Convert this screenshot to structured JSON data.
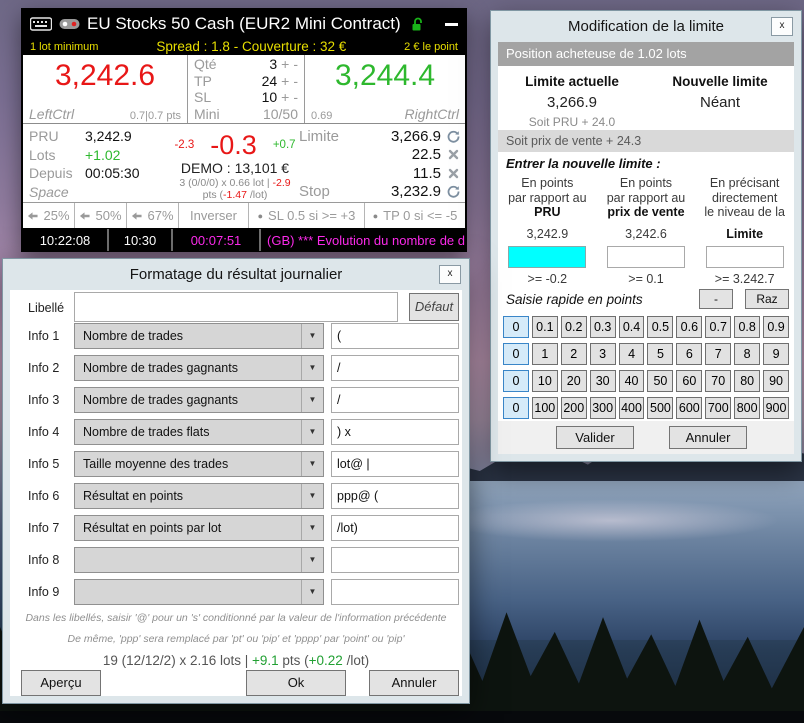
{
  "colors": {
    "sell_red": "#e81717",
    "buy_green": "#2eb82e",
    "magenta": "#ff2bee",
    "yellow": "#e8df00",
    "cyan_input": "#00ffff"
  },
  "trading_panel": {
    "title": "EU Stocks 50 Cash (EUR2 Mini Contract)",
    "info_left": "1 lot minimum",
    "info_center": "Spread : 1.8 - Couverture : 32 €",
    "info_right": "2 € le point",
    "sell_price": "3,242.6",
    "sell_key": "LeftCtrl",
    "sell_info": "0.7|0.7 pts",
    "buy_price": "3,244.4",
    "buy_key": "RightCtrl",
    "buy_info": "0.69",
    "plus": "+",
    "minus": "-",
    "order_rows": [
      {
        "label": "Qté",
        "value": "3"
      },
      {
        "label": "TP",
        "value": "24"
      },
      {
        "label": "SL",
        "value": "10"
      },
      {
        "label": "Mini",
        "value": "10/50"
      }
    ],
    "pos_rows": [
      {
        "label": "PRU",
        "value": "3,242.9"
      },
      {
        "label": "Lots",
        "value": "+1.02"
      },
      {
        "label": "Depuis",
        "value": "00:05:30"
      },
      {
        "label": "Space",
        "value": ""
      }
    ],
    "pnl_low": "-2.3",
    "pnl_main": "-0.3",
    "pnl_high": "+0.7",
    "demo": "DEMO : 13,101 €",
    "stats": {
      "p1": "3 (0/0/0) x 0.66 lot | ",
      "neg1": "-2.9",
      "p2": " pts (",
      "neg2": "-1.47",
      "p3": " /lot)"
    },
    "limite_label": "Limite",
    "limite_value": "3,266.9",
    "row2_value": "22.5",
    "row3_value": "11.5",
    "stop_label": "Stop",
    "stop_value": "3,232.9",
    "pct_buttons": [
      "25%",
      "50%",
      "67%"
    ],
    "inverser": "Inverser",
    "sl_rule": "SL 0.5 si >= +3",
    "tp_rule": "TP 0 si <= -5",
    "status": [
      "10:22:08",
      "10:30",
      "00:07:51"
    ],
    "ticker": "(GB) *** Evolution du nombre de demandeu..."
  },
  "limit_dialog": {
    "title": "Modification de la limite",
    "close": "x",
    "position_header": "Position acheteuse de 1.02 lots",
    "current_label": "Limite actuelle",
    "current_value": "3,266.9",
    "current_note": "Soit PRU + 24.0",
    "new_label": "Nouvelle limite",
    "new_value": "Néant",
    "sale_note": "Soit prix de vente + 24.3",
    "enter_label": "Entrer la nouvelle limite :",
    "col1": {
      "l1": "En points",
      "l2": "par rapport au",
      "bold": "PRU",
      "ref": "3,242.9",
      "min": ">= -0.2"
    },
    "col2": {
      "l1": "En points",
      "l2": "par rapport au",
      "bold": "prix de vente",
      "ref": "3,242.6",
      "min": ">= 0.1"
    },
    "col3": {
      "l1": "En précisant",
      "l2": "directement",
      "l3": "le niveau de la",
      "bold": "Limite",
      "min": ">= 3.242.7"
    },
    "quick_label": "Saisie rapide en points",
    "minus_button": "-",
    "raz_button": "Raz",
    "grid": [
      [
        "0",
        "0.1",
        "0.2",
        "0.3",
        "0.4",
        "0.5",
        "0.6",
        "0.7",
        "0.8",
        "0.9"
      ],
      [
        "0",
        "1",
        "2",
        "3",
        "4",
        "5",
        "6",
        "7",
        "8",
        "9"
      ],
      [
        "0",
        "10",
        "20",
        "30",
        "40",
        "50",
        "60",
        "70",
        "80",
        "90"
      ],
      [
        "0",
        "100",
        "200",
        "300",
        "400",
        "500",
        "600",
        "700",
        "800",
        "900"
      ]
    ],
    "valider": "Valider",
    "annuler": "Annuler"
  },
  "format_dialog": {
    "title": "Formatage du résultat journalier",
    "close": "x",
    "libelle_label": "Libellé",
    "libelle_value": "",
    "defaut_button": "Défaut",
    "rows": [
      {
        "label": "Info 1",
        "select": "Nombre de trades",
        "value": "("
      },
      {
        "label": "Info 2",
        "select": "Nombre de trades gagnants",
        "value": "/"
      },
      {
        "label": "Info 3",
        "select": "Nombre de trades gagnants",
        "value": "/"
      },
      {
        "label": "Info 4",
        "select": "Nombre de trades flats",
        "value": ") x"
      },
      {
        "label": "Info 5",
        "select": "Taille moyenne des trades",
        "value": "lot@ |"
      },
      {
        "label": "Info 6",
        "select": "Résultat en points",
        "value": "ppp@ ("
      },
      {
        "label": "Info 7",
        "select": "Résultat en points par lot",
        "value": "/lot)"
      },
      {
        "label": "Info 8",
        "select": "",
        "value": ""
      },
      {
        "label": "Info 9",
        "select": "",
        "value": ""
      }
    ],
    "note1": "Dans les libellés, saisir '@' pour un 's' conditionné par la valeur de l'information précédente",
    "note2": "De même, 'ppp' sera remplacé par 'pt' ou 'pip' et 'pppp' par 'point' ou 'pip'",
    "preview": {
      "p1": "19 (12/12/2) x 2.16 lots | ",
      "g1": "+9.1",
      "p2": " pts (",
      "g2": "+0.22",
      "p3": " /lot)"
    },
    "apercu": "Aperçu",
    "ok": "Ok",
    "annuler": "Annuler"
  }
}
